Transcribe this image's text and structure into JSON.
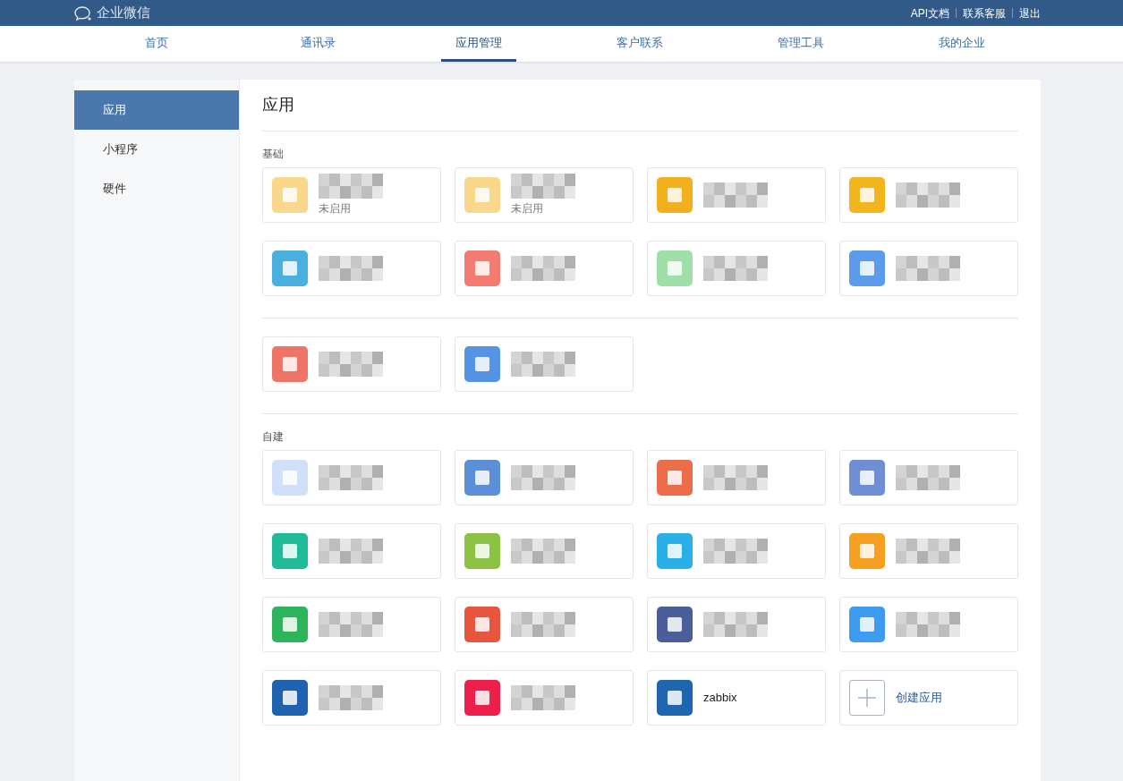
{
  "brand": {
    "name": "企业微信"
  },
  "top_links": [
    "API文档",
    "联系客服",
    "退出"
  ],
  "nav": [
    {
      "label": "首页",
      "selected": false
    },
    {
      "label": "通讯录",
      "selected": false
    },
    {
      "label": "应用管理",
      "selected": true
    },
    {
      "label": "客户联系",
      "selected": false
    },
    {
      "label": "管理工具",
      "selected": false
    },
    {
      "label": "我的企业",
      "selected": false
    }
  ],
  "sidebar": {
    "items": [
      {
        "label": "应用",
        "selected": true
      },
      {
        "label": "小程序",
        "selected": false
      },
      {
        "label": "硬件",
        "selected": false
      }
    ]
  },
  "main": {
    "title": "应用",
    "sections": [
      {
        "heading": "基础",
        "apps": [
          {
            "kind": "app",
            "color": "#f9d88b",
            "status": "未启用"
          },
          {
            "kind": "app",
            "color": "#f9d88b",
            "status": "未启用"
          },
          {
            "kind": "app",
            "color": "#f2b01e"
          },
          {
            "kind": "app",
            "color": "#f3b51e"
          },
          {
            "kind": "app",
            "color": "#4ab0e0"
          },
          {
            "kind": "app",
            "color": "#f47b72"
          },
          {
            "kind": "app",
            "color": "#9fe0a8"
          },
          {
            "kind": "app",
            "color": "#5b9bea"
          }
        ]
      },
      {
        "apps": [
          {
            "kind": "app",
            "color": "#ef7468"
          },
          {
            "kind": "app",
            "color": "#5594e4"
          }
        ]
      },
      {
        "heading": "自建",
        "apps": [
          {
            "kind": "app",
            "color": "#cfe0f8"
          },
          {
            "kind": "app",
            "color": "#5b8fd8"
          },
          {
            "kind": "app",
            "color": "#ec6d4a"
          },
          {
            "kind": "app",
            "color": "#6f8ed4"
          },
          {
            "kind": "app",
            "color": "#20bc9a"
          },
          {
            "kind": "app",
            "color": "#8cc243"
          },
          {
            "kind": "app",
            "color": "#2ab0e8"
          },
          {
            "kind": "app",
            "color": "#f5a020"
          },
          {
            "kind": "app",
            "color": "#2eb45a"
          },
          {
            "kind": "app",
            "color": "#e8553f"
          },
          {
            "kind": "app",
            "color": "#4a5f9a"
          },
          {
            "kind": "app",
            "color": "#3d9cf0"
          },
          {
            "kind": "app",
            "color": "#1e62b0"
          },
          {
            "kind": "app",
            "color": "#ef1f4c"
          },
          {
            "kind": "app",
            "color": "#1f66b0",
            "name": "zabbix"
          },
          {
            "kind": "create",
            "name": "创建应用"
          }
        ]
      }
    ]
  }
}
